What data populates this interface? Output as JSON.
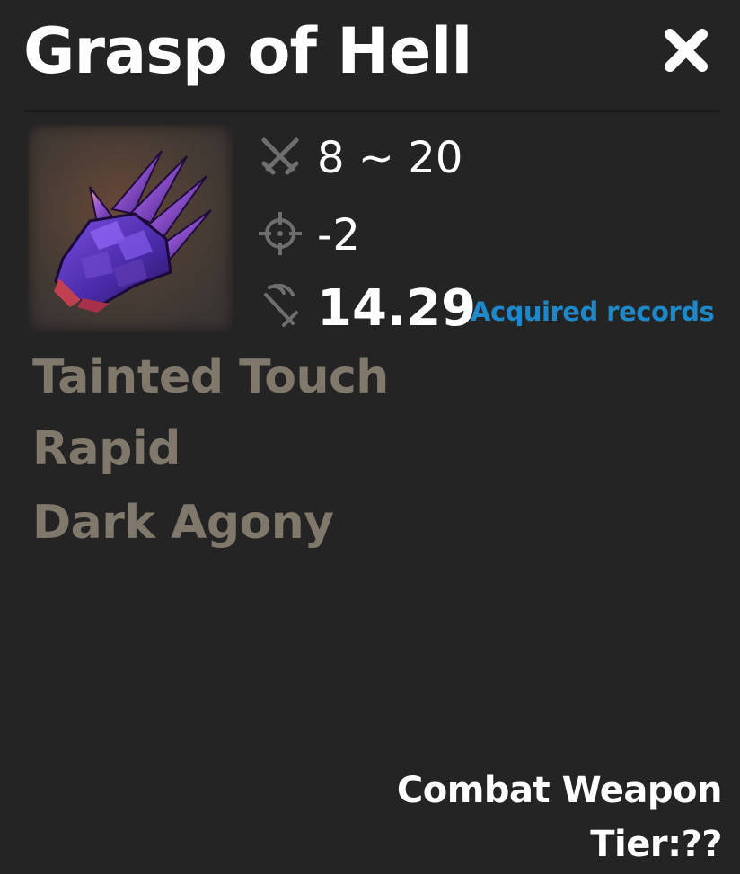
{
  "item": {
    "name": "Grasp of Hell",
    "icon": "claw-gauntlet-icon"
  },
  "close_icon": "close-icon",
  "stats": {
    "damage": {
      "icon": "crossed-swords-icon",
      "value": "8 ~ 20"
    },
    "accuracy": {
      "icon": "crosshair-icon",
      "value": "-2"
    },
    "speed": {
      "icon": "speed-sword-icon",
      "value": "14.29"
    }
  },
  "records_link": "Acquired records",
  "traits": [
    "Tainted Touch",
    "Rapid",
    "Dark Agony"
  ],
  "footer": {
    "type": "Combat Weapon",
    "tier": "Tier:??"
  },
  "colors": {
    "background": "#242424",
    "trait_text": "#7f786b",
    "link": "#1e88c8",
    "icon_gray": "#6e6e6e"
  }
}
